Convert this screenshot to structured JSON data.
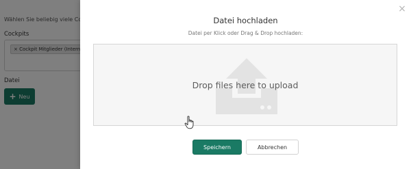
{
  "background": {
    "hint": "Wählen Sie beliebig viele Coc",
    "cockpits_label": "Cockpits",
    "tag_remove": "×",
    "tag_label": "Cockpit Mitglieder (Intern",
    "datei_label": "Datei",
    "new_button_icon": "+",
    "new_button_label": "Neu"
  },
  "modal": {
    "close_symbol": "×",
    "title": "Datei hochladen",
    "subtitle": "Datei per Klick oder Drag & Drop hochladen:",
    "dropzone_text": "Drop files here to upload",
    "save_label": "Speichern",
    "cancel_label": "Abbrechen"
  },
  "colors": {
    "primary": "#1a7a64",
    "overlay": "rgba(0,0,0,0.5)",
    "dropzone_bg": "#f6f6f6"
  },
  "icons": {
    "upload": "upload-tray-icon",
    "cursor": "hand-pointer-icon",
    "close": "close-icon"
  }
}
